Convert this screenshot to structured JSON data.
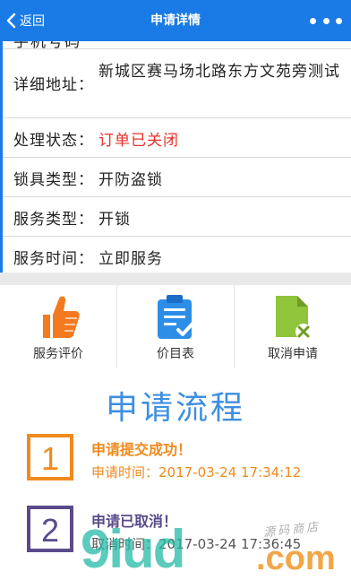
{
  "header": {
    "back_label": "返回",
    "title": "申请详情"
  },
  "details": {
    "partial_row_text": "手机号码",
    "rows": [
      {
        "key": "详细地址：",
        "value": "新城区赛马场北路东方文苑旁测试",
        "status": false
      },
      {
        "key": "处理状态：",
        "value": "订单已关闭",
        "status": true
      },
      {
        "key": "锁具类型：",
        "value": "开防盗锁",
        "status": false
      },
      {
        "key": "服务类型：",
        "value": "开锁",
        "status": false
      },
      {
        "key": "服务时间：",
        "value": "立即服务",
        "status": false
      }
    ]
  },
  "actions": [
    {
      "label": "服务评价",
      "icon": "thumbs-up-icon"
    },
    {
      "label": "价目表",
      "icon": "clipboard-list-icon"
    },
    {
      "label": "取消申请",
      "icon": "document-cancel-icon"
    }
  ],
  "flow": {
    "title": "申请流程",
    "steps": [
      {
        "number": "1",
        "title": "申请提交成功！",
        "time": "申请时间：2017-03-24 17:34:12"
      },
      {
        "number": "2",
        "title": "申请已取消！",
        "time": "取消时间：2017-03-24 17:36:45"
      }
    ]
  },
  "watermark": {
    "main": "9iud",
    "suffix": ".com",
    "sub": "源码商店"
  },
  "colors": {
    "primary": "#1a7be6",
    "status_closed": "#e8302a",
    "step_active": "#f08a1e",
    "step_cancelled": "#5a4a8a",
    "flow_title": "#3d8fe0"
  }
}
